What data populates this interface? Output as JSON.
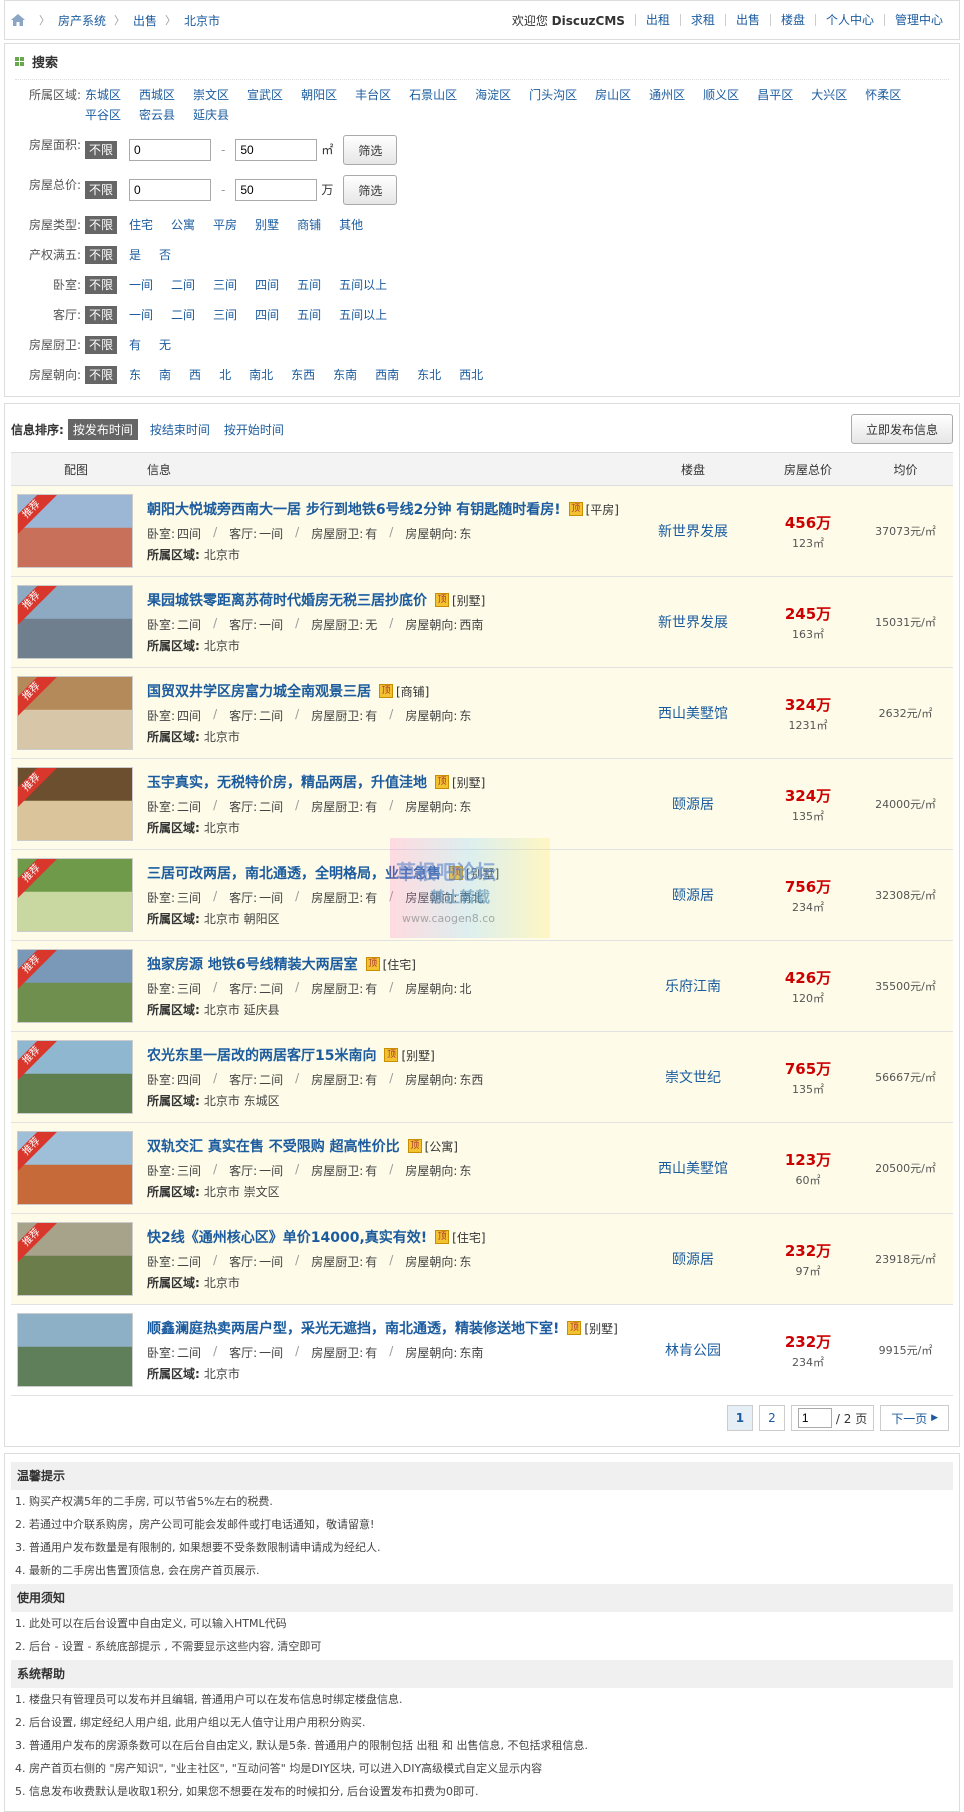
{
  "breadcrumb": [
    "房产系统",
    "出售",
    "北京市"
  ],
  "topnav": {
    "welcome_prefix": "欢迎您",
    "username": "DiscuzCMS",
    "links": [
      "出租",
      "求租",
      "出售",
      "楼盘",
      "个人中心",
      "管理中心"
    ]
  },
  "search": {
    "title": "搜索",
    "district_label": "所属区域:",
    "districts": [
      "东城区",
      "西城区",
      "崇文区",
      "宣武区",
      "朝阳区",
      "丰台区",
      "石景山区",
      "海淀区",
      "门头沟区",
      "房山区",
      "通州区",
      "顺义区",
      "昌平区",
      "大兴区",
      "怀柔区",
      "平谷区",
      "密云县",
      "延庆县"
    ],
    "area": {
      "label": "房屋面积:",
      "unlimited": "不限",
      "from": "0",
      "to": "50",
      "unit": "㎡",
      "button": "筛选"
    },
    "price": {
      "label": "房屋总价:",
      "unlimited": "不限",
      "from": "0",
      "to": "50",
      "unit": "万",
      "button": "筛选"
    },
    "type": {
      "label": "房屋类型:",
      "unlimited": "不限",
      "options": [
        "住宅",
        "公寓",
        "平房",
        "别墅",
        "商铺",
        "其他"
      ]
    },
    "fiveyear": {
      "label": "产权满五:",
      "unlimited": "不限",
      "options": [
        "是",
        "否"
      ]
    },
    "bedroom": {
      "label": "卧室:",
      "unlimited": "不限",
      "options": [
        "一间",
        "二间",
        "三间",
        "四间",
        "五间",
        "五间以上"
      ]
    },
    "living": {
      "label": "客厅:",
      "unlimited": "不限",
      "options": [
        "一间",
        "二间",
        "三间",
        "四间",
        "五间",
        "五间以上"
      ]
    },
    "kitchen": {
      "label": "房屋厨卫:",
      "unlimited": "不限",
      "options": [
        "有",
        "无"
      ]
    },
    "orient": {
      "label": "房屋朝向:",
      "unlimited": "不限",
      "options": [
        "东",
        "南",
        "西",
        "北",
        "南北",
        "东西",
        "东南",
        "西南",
        "东北",
        "西北"
      ]
    }
  },
  "sort": {
    "label": "信息排序:",
    "selected": "按发布时间",
    "options": [
      "按结束时间",
      "按开始时间"
    ],
    "publish_button": "立即发布信息"
  },
  "table_headers": {
    "img": "配图",
    "info": "信息",
    "lp": "楼盘",
    "price": "房屋总价",
    "avg": "均价"
  },
  "labels": {
    "bedroom": "卧室:",
    "living": "客厅:",
    "kitchen": "房屋厨卫:",
    "orient": "房屋朝向:",
    "area": "所属区域:",
    "ding": "顶",
    "ribbon": "推荐"
  },
  "listings": [
    {
      "title": "朝阳大悦城旁西南大一居 步行到地铁6号线2分钟 有钥匙随时看房!",
      "type": "[平房]",
      "bedroom": "四间",
      "living": "一间",
      "kitchen": "有",
      "orient": "东",
      "area": "北京市",
      "lp": "新世界发展",
      "total": "456万",
      "size": "123㎡",
      "avg": "37073元/㎡",
      "rec": true
    },
    {
      "title": "果园城铁零距离苏荷时代婚房无税三居抄底价",
      "type": "[别墅]",
      "bedroom": "二间",
      "living": "一间",
      "kitchen": "无",
      "orient": "西南",
      "area": "北京市",
      "lp": "新世界发展",
      "total": "245万",
      "size": "163㎡",
      "avg": "15031元/㎡",
      "rec": true
    },
    {
      "title": "国贸双井学区房富力城全南观景三居",
      "type": "[商铺]",
      "bedroom": "四间",
      "living": "二间",
      "kitchen": "有",
      "orient": "东",
      "area": "北京市",
      "lp": "西山美墅馆",
      "total": "324万",
      "size": "1231㎡",
      "avg": "2632元/㎡",
      "rec": true
    },
    {
      "title": "玉宇真实，无税特价房，精品两居，升值洼地",
      "type": "[别墅]",
      "bedroom": "二间",
      "living": "二间",
      "kitchen": "有",
      "orient": "东",
      "area": "北京市",
      "lp": "颐源居",
      "total": "324万",
      "size": "135㎡",
      "avg": "24000元/㎡",
      "rec": true
    },
    {
      "title": "三居可改两居，南北通透，全明格局，业主急售",
      "type": "[别墅]",
      "bedroom": "三间",
      "living": "一间",
      "kitchen": "有",
      "orient": "南北",
      "area": "北京市 朝阳区",
      "lp": "颐源居",
      "total": "756万",
      "size": "234㎡",
      "avg": "32308元/㎡",
      "rec": true
    },
    {
      "title": "独家房源 地铁6号线精装大两居室",
      "type": "[住宅]",
      "bedroom": "三间",
      "living": "二间",
      "kitchen": "有",
      "orient": "北",
      "area": "北京市 延庆县",
      "lp": "乐府江南",
      "total": "426万",
      "size": "120㎡",
      "avg": "35500元/㎡",
      "rec": true
    },
    {
      "title": "农光东里一居改的两居客厅15米南向",
      "type": "[别墅]",
      "bedroom": "四间",
      "living": "二间",
      "kitchen": "有",
      "orient": "东西",
      "area": "北京市 东城区",
      "lp": "崇文世纪",
      "total": "765万",
      "size": "135㎡",
      "avg": "56667元/㎡",
      "rec": true
    },
    {
      "title": "双轨交汇 真实在售 不受限购 超高性价比",
      "type": "[公寓]",
      "bedroom": "三间",
      "living": "一间",
      "kitchen": "有",
      "orient": "东",
      "area": "北京市 崇文区",
      "lp": "西山美墅馆",
      "total": "123万",
      "size": "60㎡",
      "avg": "20500元/㎡",
      "rec": true
    },
    {
      "title": "快2线《通州核心区》单价14000,真实有效!",
      "type": "[住宅]",
      "bedroom": "二间",
      "living": "一间",
      "kitchen": "有",
      "orient": "东",
      "area": "北京市",
      "lp": "颐源居",
      "total": "232万",
      "size": "97㎡",
      "avg": "23918元/㎡",
      "rec": true
    },
    {
      "title": "顺鑫澜庭热卖两居户型，采光无遮挡，南北通透，精装修送地下室!",
      "type": "[别墅]",
      "bedroom": "二间",
      "living": "一间",
      "kitchen": "有",
      "orient": "东南",
      "area": "北京市",
      "lp": "林肯公园",
      "total": "232万",
      "size": "234㎡",
      "avg": "9915元/㎡",
      "rec": false
    }
  ],
  "pager": {
    "pages": [
      "1",
      "2"
    ],
    "current_input": "1",
    "total_text": "/ 2 页",
    "next": "下一页"
  },
  "tips": {
    "warm_title": "温馨提示",
    "warm": [
      "1. 购买产权满5年的二手房, 可以节省5%左右的税费.",
      "2. 若通过中介联系购房，房产公司可能会发邮件或打电话通知，敬请留意!",
      "3. 普通用户发布数量是有限制的, 如果想要不受条数限制请申请成为经纪人.",
      "4. 最新的二手房出售置顶信息, 会在房产首页展示."
    ],
    "usage_title": "使用须知",
    "usage": [
      "1. 此处可以在后台设置中自由定义, 可以输入HTML代码",
      "2. 后台 - 设置 - 系统底部提示 , 不需要显示这些内容, 清空即可"
    ],
    "help_title": "系统帮助",
    "help": [
      "1. 楼盘只有管理员可以发布并且编辑, 普通用户可以在发布信息时绑定楼盘信息.",
      "2. 后台设置, 绑定经纪人用户组, 此用户组以无人值守让用户用积分购买.",
      "3. 普通用户发布的房源条数可以在后台自由定义, 默认是5条. 普通用户的限制包括 出租 和 出售信息, 不包括求租信息.",
      "4. 房产首页右侧的 \"房产知识\", \"业主社区\", \"互动问答\" 均是DIY区块, 可以进入DIY高级模式自定义显示内容",
      "5. 信息发布收费默认是收取1积分, 如果您不想要在发布的时候扣分, 后台设置发布扣费为0即可."
    ]
  },
  "watermark": {
    "line1": "草根吧论坛",
    "line2": "禁止转载",
    "line3": "www.caogen8.co"
  },
  "colors": {
    "link": "#1b5b9e",
    "price": "#cc0000",
    "highlight_row": "#fefce9",
    "ribbon": "#d9362c"
  }
}
